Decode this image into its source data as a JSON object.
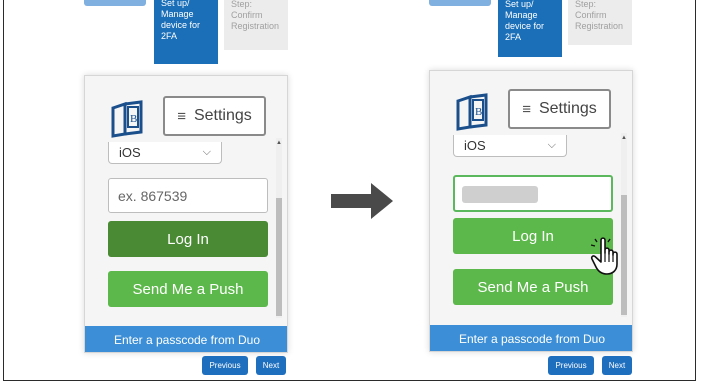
{
  "colors": {
    "step_active_bg": "#1a6fb8",
    "login_dark": "#4a8a35",
    "login_light": "#5cb84a",
    "push": "#5cb84a",
    "footer": "#3c8fd6",
    "nav_button": "#1f6fbf",
    "arrow": "#4a4a4a"
  },
  "left": {
    "step_active_lines": [
      "Set up/",
      "Manage",
      "device for",
      "2FA"
    ],
    "step_inactive_lines": [
      "Step:",
      "Confirm",
      "Registration"
    ],
    "settings_label": "Settings",
    "device_select_value": "iOS",
    "passcode_placeholder": "ex. 867539",
    "login_label": "Log In",
    "push_label": "Send Me a Push",
    "footer_text": "Enter a passcode from Duo",
    "previous_label": "Previous",
    "next_label": "Next"
  },
  "right": {
    "step_active_lines": [
      "Set up/",
      "Manage",
      "device for",
      "2FA"
    ],
    "step_inactive_lines": [
      "Step:",
      "Confirm",
      "Registration"
    ],
    "settings_label": "Settings",
    "device_select_value": "iOS",
    "login_label": "Log In",
    "push_label": "Send Me a Push",
    "footer_text": "Enter a passcode from Duo",
    "previous_label": "Previous",
    "next_label": "Next"
  },
  "icons": {
    "logo": "book-logo-icon",
    "arrow": "right-arrow-icon",
    "cursor": "hand-pointer-icon",
    "settings": "hamburger-icon",
    "select": "chevron-down-icon"
  }
}
